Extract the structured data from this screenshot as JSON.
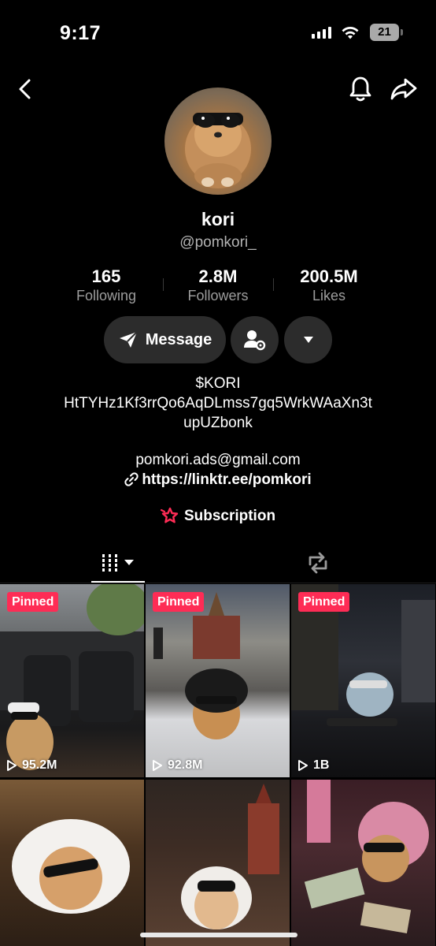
{
  "status_bar": {
    "time": "9:17",
    "battery": "21"
  },
  "profile": {
    "display_name": "kori",
    "username": "@pomkori_",
    "stats": [
      {
        "value": "165",
        "label": "Following"
      },
      {
        "value": "2.8M",
        "label": "Followers"
      },
      {
        "value": "200.5M",
        "label": "Likes"
      }
    ],
    "message_label": "Message",
    "bio_lines": [
      "$KORI",
      "HtTYHz1Kf3rrQo6AqDLmss7gq5WrkWAaXn3t",
      "upUZbonk"
    ],
    "email": "pomkori.ads@gmail.com",
    "link": "https://linktr.ee/pomkori",
    "subscription_label": "Subscription"
  },
  "tabs": {
    "active": "videos-grid",
    "items": [
      "videos-grid",
      "reposts"
    ]
  },
  "videos": [
    {
      "pinned_label": "Pinned",
      "views": "95.2M"
    },
    {
      "pinned_label": "Pinned",
      "views": "92.8M"
    },
    {
      "pinned_label": "Pinned",
      "views": "1B"
    },
    {
      "pinned_label": "",
      "views": ""
    },
    {
      "pinned_label": "",
      "views": ""
    },
    {
      "pinned_label": "",
      "views": ""
    }
  ],
  "colors": {
    "accent": "#fe2c55",
    "button_bg": "#2c2c2c",
    "muted_text": "#9d9d9d"
  }
}
